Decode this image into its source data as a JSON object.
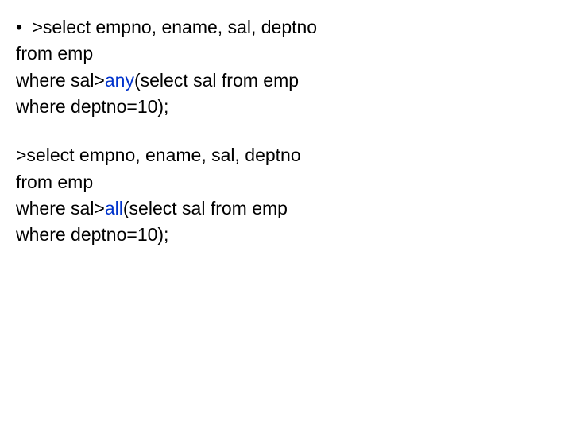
{
  "block1": {
    "bullet": "•",
    "l1_a": ">select empno, ename, sal, deptno",
    "l2": "from emp",
    "l3_a": "where sal>",
    "l3_kw": "any",
    "l3_b": "(select sal from emp",
    "l4": "where deptno=10);"
  },
  "block2": {
    "l1": ">select empno, ename, sal, deptno",
    "l2": "from emp",
    "l3_a": "where sal>",
    "l3_kw": "all",
    "l3_b": "(select sal from emp",
    "l4": "where deptno=10);"
  }
}
